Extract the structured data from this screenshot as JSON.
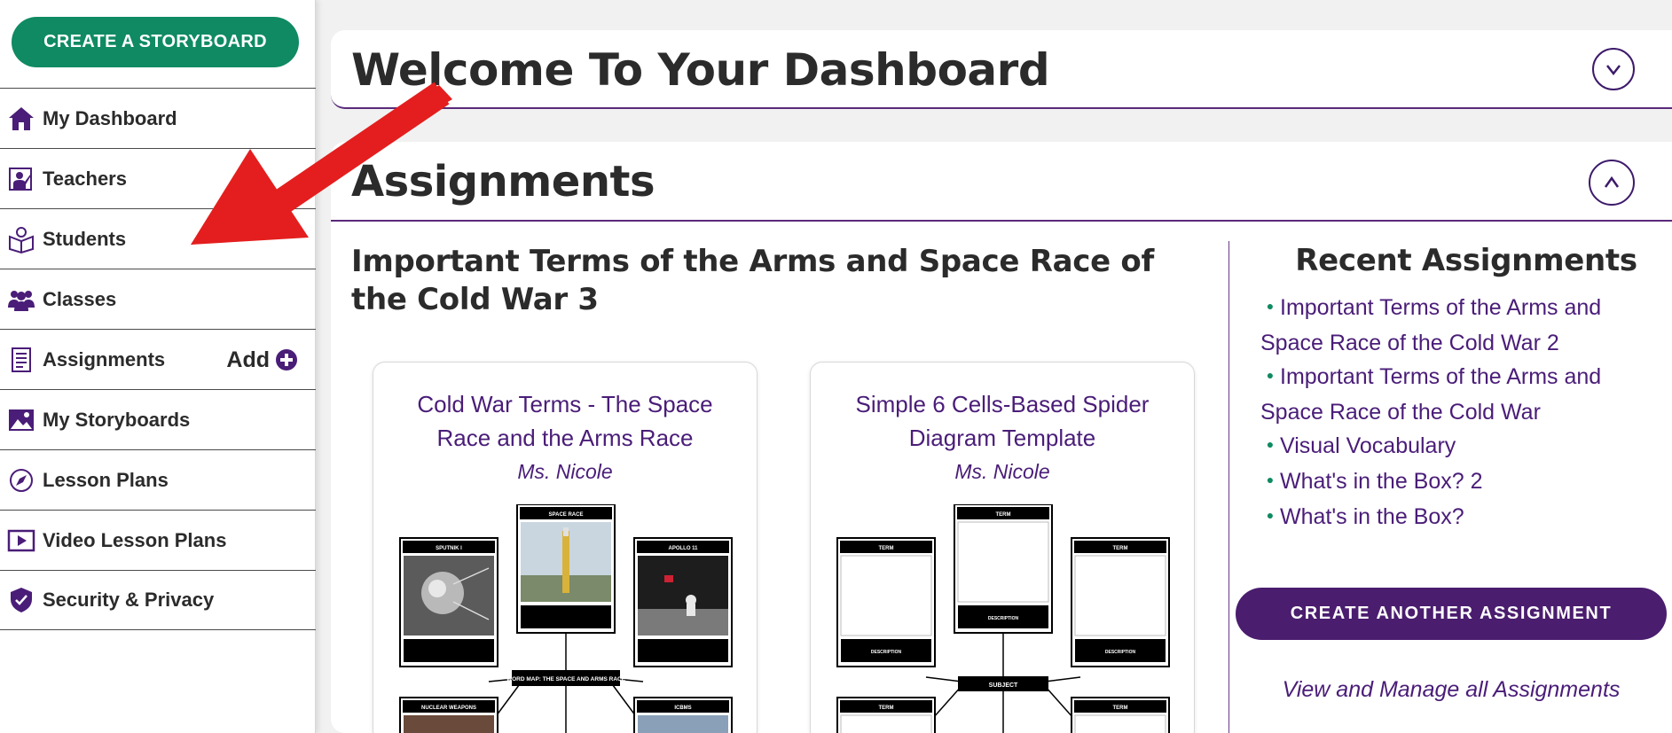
{
  "sidebar": {
    "create_button": "CREATE A STORYBOARD",
    "items": [
      {
        "label": "My Dashboard",
        "icon": "home-icon"
      },
      {
        "label": "Teachers",
        "icon": "teacher-icon"
      },
      {
        "label": "Students",
        "icon": "student-icon"
      },
      {
        "label": "Classes",
        "icon": "classes-icon"
      },
      {
        "label": "Assignments",
        "icon": "assignments-icon"
      },
      {
        "label": "My Storyboards",
        "icon": "storyboards-icon"
      },
      {
        "label": "Lesson Plans",
        "icon": "lesson-plans-icon"
      },
      {
        "label": "Video Lesson Plans",
        "icon": "video-icon"
      },
      {
        "label": "Security & Privacy",
        "icon": "shield-icon"
      }
    ],
    "add_label": "Add"
  },
  "welcome": {
    "title": "Welcome To Your Dashboard"
  },
  "assignments": {
    "title": "Assignments",
    "current_title": "Important Terms of the Arms and Space Race of the Cold War 3",
    "cards": [
      {
        "title": "Cold War Terms - The Space Race and the Arms Race",
        "author": "Ms. Nicole",
        "thumb": {
          "center": "WORD MAP: THE SPACE AND ARMS RACE",
          "cells": [
            "SPUTNIK I",
            "SPACE RACE",
            "APOLLO 11",
            "NUCLEAR WEAPONS",
            "ICBMS"
          ]
        }
      },
      {
        "title": "Simple 6 Cells-Based Spider Diagram Template",
        "author": "Ms. Nicole",
        "thumb": {
          "center": "SUBJECT",
          "cells": [
            "TERM",
            "TERM",
            "TERM",
            "TERM",
            "TERM"
          ],
          "descriptions": [
            "DESCRIPTION",
            "DESCRIPTION",
            "DESCRIPTION"
          ]
        }
      }
    ],
    "recent_title": "Recent Assignments",
    "recent": [
      "Important Terms of the Arms and Space Race of the Cold War 2",
      "Important Terms of the Arms and Space Race of the Cold War",
      "Visual Vocabulary",
      "What's in the Box? 2",
      "What's in the Box?"
    ],
    "create_another": "CREATE ANOTHER ASSIGNMENT",
    "view_all": "View and Manage all Assignments"
  },
  "colors": {
    "brand_green": "#0f8a62",
    "brand_purple": "#4a1d6e",
    "link_purple": "#4a1d78",
    "arrow_red": "#e41e1e"
  }
}
